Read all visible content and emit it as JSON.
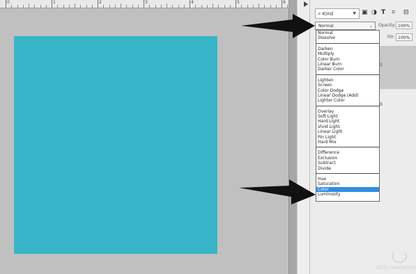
{
  "ruler": {
    "labels": [
      "0",
      "1",
      "2",
      "3",
      "4",
      "5",
      "6"
    ]
  },
  "layers_panel": {
    "filter": {
      "label": "Kind",
      "icons": [
        "image-filter-icon",
        "adjustment-filter-icon",
        "type-filter-icon",
        "shape-filter-icon",
        "smart-object-filter-icon"
      ]
    },
    "blend_mode": {
      "value": "Normal"
    },
    "opacity": {
      "label": "Opacity:",
      "value": "100%"
    },
    "fill": {
      "label": "Fill:",
      "value": "100%"
    },
    "layer_numbers": [
      "1",
      "0"
    ]
  },
  "blend_list": {
    "groups": [
      [
        "Normal",
        "Dissolve"
      ],
      [
        "Darken",
        "Multiply",
        "Color Burn",
        "Linear Burn",
        "Darker Color"
      ],
      [
        "Lighten",
        "Screen",
        "Color Dodge",
        "Linear Dodge (Add)",
        "Lighter Color"
      ],
      [
        "Overlay",
        "Soft Light",
        "Hard Light",
        "Vivid Light",
        "Linear Light",
        "Pin Light",
        "Hard Mix"
      ],
      [
        "Difference",
        "Exclusion",
        "Subtract",
        "Divide"
      ],
      [
        "Hue",
        "Saturation",
        "Color",
        "Luminosity"
      ]
    ],
    "selected": "Color"
  },
  "colors": {
    "document_fill": "#38b5c8",
    "selection": "#2f8de4"
  },
  "watermark": {
    "text": "AllScreenshots"
  }
}
